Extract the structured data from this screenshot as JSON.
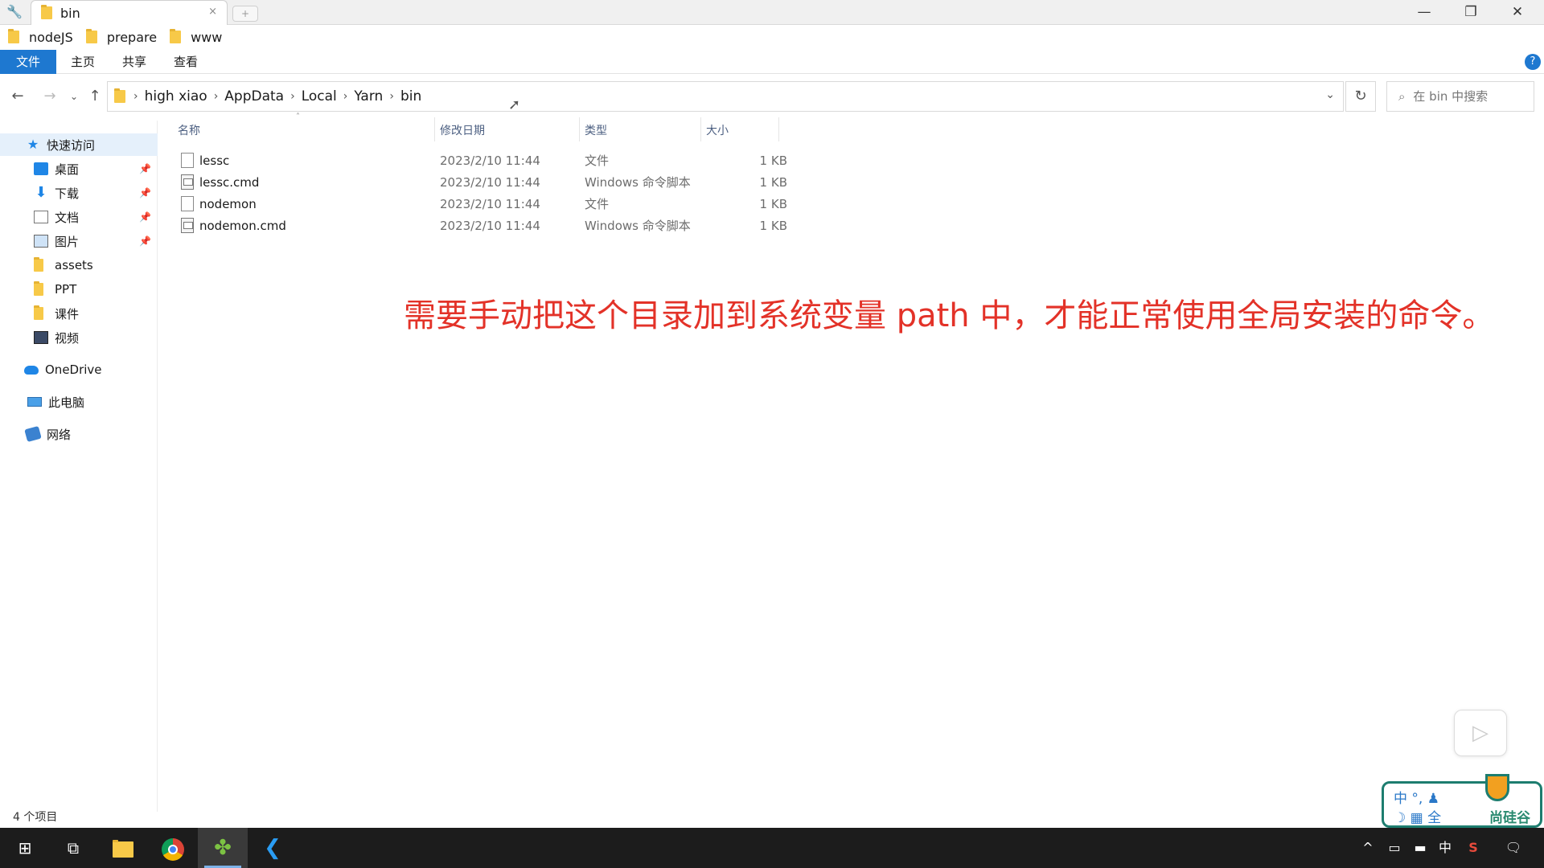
{
  "window": {
    "tab_title": "bin",
    "tab_close": "×",
    "new_tab": "+",
    "minimize": "—",
    "restore": "❐",
    "close": "✕"
  },
  "bookmarks": [
    "nodeJS",
    "prepare",
    "www"
  ],
  "ribbon": {
    "tabs": [
      "文件",
      "主页",
      "共享",
      "查看"
    ],
    "help": "?"
  },
  "address": {
    "crumbs": [
      "high xiao",
      "AppData",
      "Local",
      "Yarn",
      "bin"
    ],
    "search_placeholder": "在 bin 中搜索"
  },
  "sidebar": {
    "quick_access": "快速访问",
    "items": [
      "桌面",
      "下载",
      "文档",
      "图片",
      "assets",
      "PPT",
      "课件",
      "视频"
    ],
    "onedrive": "OneDrive",
    "this_pc": "此电脑",
    "network": "网络"
  },
  "columns": [
    "名称",
    "修改日期",
    "类型",
    "大小"
  ],
  "files": [
    {
      "name": "lessc",
      "date": "2023/2/10 11:44",
      "type": "文件",
      "size": "1 KB",
      "icon": "file-icon"
    },
    {
      "name": "lessc.cmd",
      "date": "2023/2/10 11:44",
      "type": "Windows 命令脚本",
      "size": "1 KB",
      "icon": "cmd-icon"
    },
    {
      "name": "nodemon",
      "date": "2023/2/10 11:44",
      "type": "文件",
      "size": "1 KB",
      "icon": "file-icon"
    },
    {
      "name": "nodemon.cmd",
      "date": "2023/2/10 11:44",
      "type": "Windows 命令脚本",
      "size": "1 KB",
      "icon": "cmd-icon"
    }
  ],
  "annotation": "需要手动把这个目录加到系统变量 path 中，才能正常使用全局安装的命令。",
  "status": "4 个项目",
  "ime_widget": {
    "line1": "中 °, ♟",
    "line2": "☽ ▦ 全",
    "brand": "尚硅谷"
  },
  "taskbar": {
    "ime_lang": "中"
  },
  "colors": {
    "accent": "#1e78d0",
    "annotation": "#e33228",
    "taskbar": "#1c1c1c"
  }
}
